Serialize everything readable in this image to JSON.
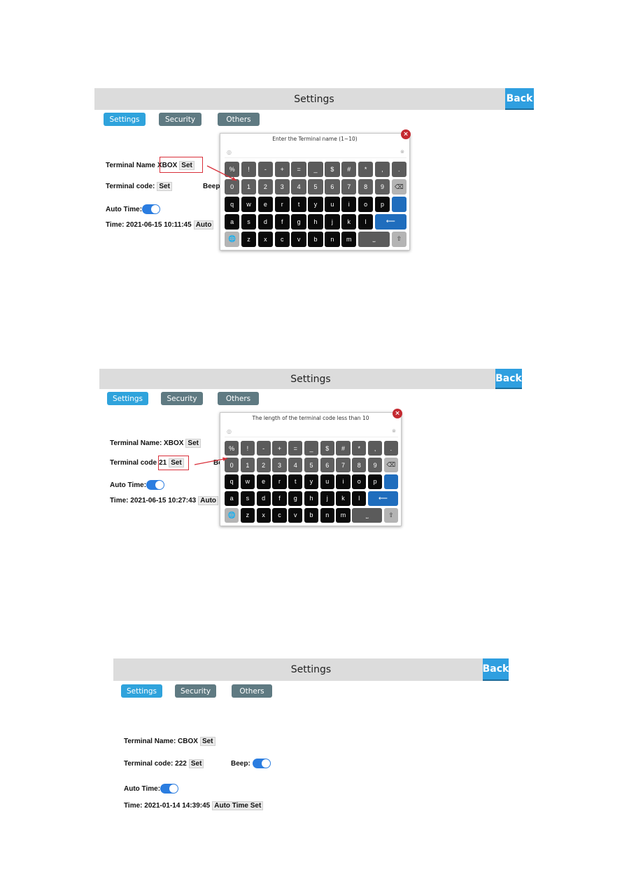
{
  "colors": {
    "header": "#dcdcdc",
    "back": "#2f9fe0",
    "tab_active": "#2fa3dc",
    "tab_inactive": "#5f7a82",
    "toggle_on": "#2b7de0",
    "enter_key": "#1f6dbd",
    "annotation": "#d9303a"
  },
  "keyboard_keys": {
    "row1": [
      "%",
      "!",
      "-",
      "+",
      "=",
      "_",
      "$",
      "#",
      "*",
      ",",
      "."
    ],
    "row2": [
      "0",
      "1",
      "2",
      "3",
      "4",
      "5",
      "6",
      "7",
      "8",
      "9"
    ],
    "row3": [
      "q",
      "w",
      "e",
      "r",
      "t",
      "y",
      "u",
      "i",
      "o",
      "p"
    ],
    "row4": [
      "a",
      "s",
      "d",
      "f",
      "g",
      "h",
      "j",
      "k",
      "l"
    ],
    "row5": [
      "z",
      "x",
      "c",
      "v",
      "b",
      "n",
      "m"
    ],
    "icons": {
      "backspace": "backspace-icon",
      "enter": "enter-icon",
      "globe": "globe-icon",
      "space": "space-icon",
      "shift": "shift-icon",
      "eye": "eye-icon",
      "clear": "clear-icon",
      "close": "close-icon"
    }
  },
  "panels": [
    {
      "title": "Settings",
      "back": "Back",
      "tabs": [
        "Settings",
        "Security",
        "Others"
      ],
      "name_label": "Terminal Name",
      "name_value": "XBOX",
      "set": "Set",
      "code_label": "Terminal code:",
      "code_value": "",
      "beep_label": "Beep",
      "auto_time_label": "Auto Time:",
      "auto_time_on": true,
      "time_label": "Time: 2021-06-15 10:11:45",
      "time_button": "Auto",
      "keyboard_prompt": "Enter the Terminal name (1~10)"
    },
    {
      "title": "Settings",
      "back": "Back",
      "tabs": [
        "Settings",
        "Security",
        "Others"
      ],
      "name_label": "Terminal Name: XBOX",
      "name_value": "",
      "set": "Set",
      "code_label": "Terminal code",
      "code_value": "21",
      "beep_label": "Be",
      "auto_time_label": "Auto Time:",
      "auto_time_on": true,
      "time_label": "Time: 2021-06-15 10:27:43",
      "time_button": "Auto",
      "keyboard_prompt": "The length of the terminal code less than 10"
    },
    {
      "title": "Settings",
      "back": "Back",
      "tabs": [
        "Settings",
        "Security",
        "Others"
      ],
      "name_label": "Terminal Name: CBOX",
      "name_value": "",
      "set": "Set",
      "code_label": "Terminal code: 222",
      "code_value": "",
      "beep_label": "Beep:",
      "beep_on": true,
      "auto_time_label": "Auto Time:",
      "auto_time_on": true,
      "time_label": "Time: 2021-01-14 14:39:45",
      "time_button": "Auto Time Set"
    }
  ]
}
